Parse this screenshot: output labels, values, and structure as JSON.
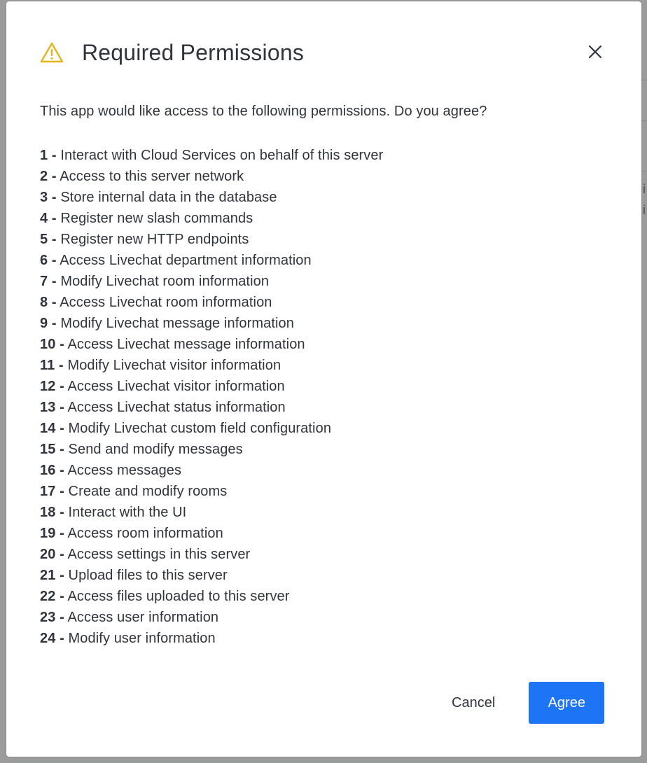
{
  "dialog": {
    "title": "Required Permissions",
    "intro": "This app would like access to the following permissions. Do you agree?",
    "permissions": [
      {
        "num": "1 -",
        "text": "Interact with Cloud Services on behalf of this server"
      },
      {
        "num": "2 -",
        "text": "Access to this server network"
      },
      {
        "num": "3 -",
        "text": "Store internal data in the database"
      },
      {
        "num": "4 -",
        "text": "Register new slash commands"
      },
      {
        "num": "5 -",
        "text": "Register new HTTP endpoints"
      },
      {
        "num": "6 -",
        "text": "Access Livechat department information"
      },
      {
        "num": "7 -",
        "text": "Modify Livechat room information"
      },
      {
        "num": "8 -",
        "text": "Access Livechat room information"
      },
      {
        "num": "9 -",
        "text": "Modify Livechat message information"
      },
      {
        "num": "10 -",
        "text": "Access Livechat message information"
      },
      {
        "num": "11 -",
        "text": "Modify Livechat visitor information"
      },
      {
        "num": "12 -",
        "text": "Access Livechat visitor information"
      },
      {
        "num": "13 -",
        "text": "Access Livechat status information"
      },
      {
        "num": "14 -",
        "text": "Modify Livechat custom field configuration"
      },
      {
        "num": "15 -",
        "text": "Send and modify messages"
      },
      {
        "num": "16 -",
        "text": "Access messages"
      },
      {
        "num": "17 -",
        "text": "Create and modify rooms"
      },
      {
        "num": "18 -",
        "text": "Interact with the UI"
      },
      {
        "num": "19 -",
        "text": "Access room information"
      },
      {
        "num": "20 -",
        "text": "Access settings in this server"
      },
      {
        "num": "21 -",
        "text": "Upload files to this server"
      },
      {
        "num": "22 -",
        "text": "Access files uploaded to this server"
      },
      {
        "num": "23 -",
        "text": "Access user information"
      },
      {
        "num": "24 -",
        "text": "Modify user information"
      }
    ],
    "cancel_label": "Cancel",
    "agree_label": "Agree",
    "icons": {
      "header": "warning-icon",
      "close": "close-icon"
    },
    "colors": {
      "warning": "#e4b41d",
      "primary": "#1d74f5",
      "text": "#2f343d"
    }
  },
  "background": {
    "glyphs": [
      "i",
      "i"
    ]
  }
}
